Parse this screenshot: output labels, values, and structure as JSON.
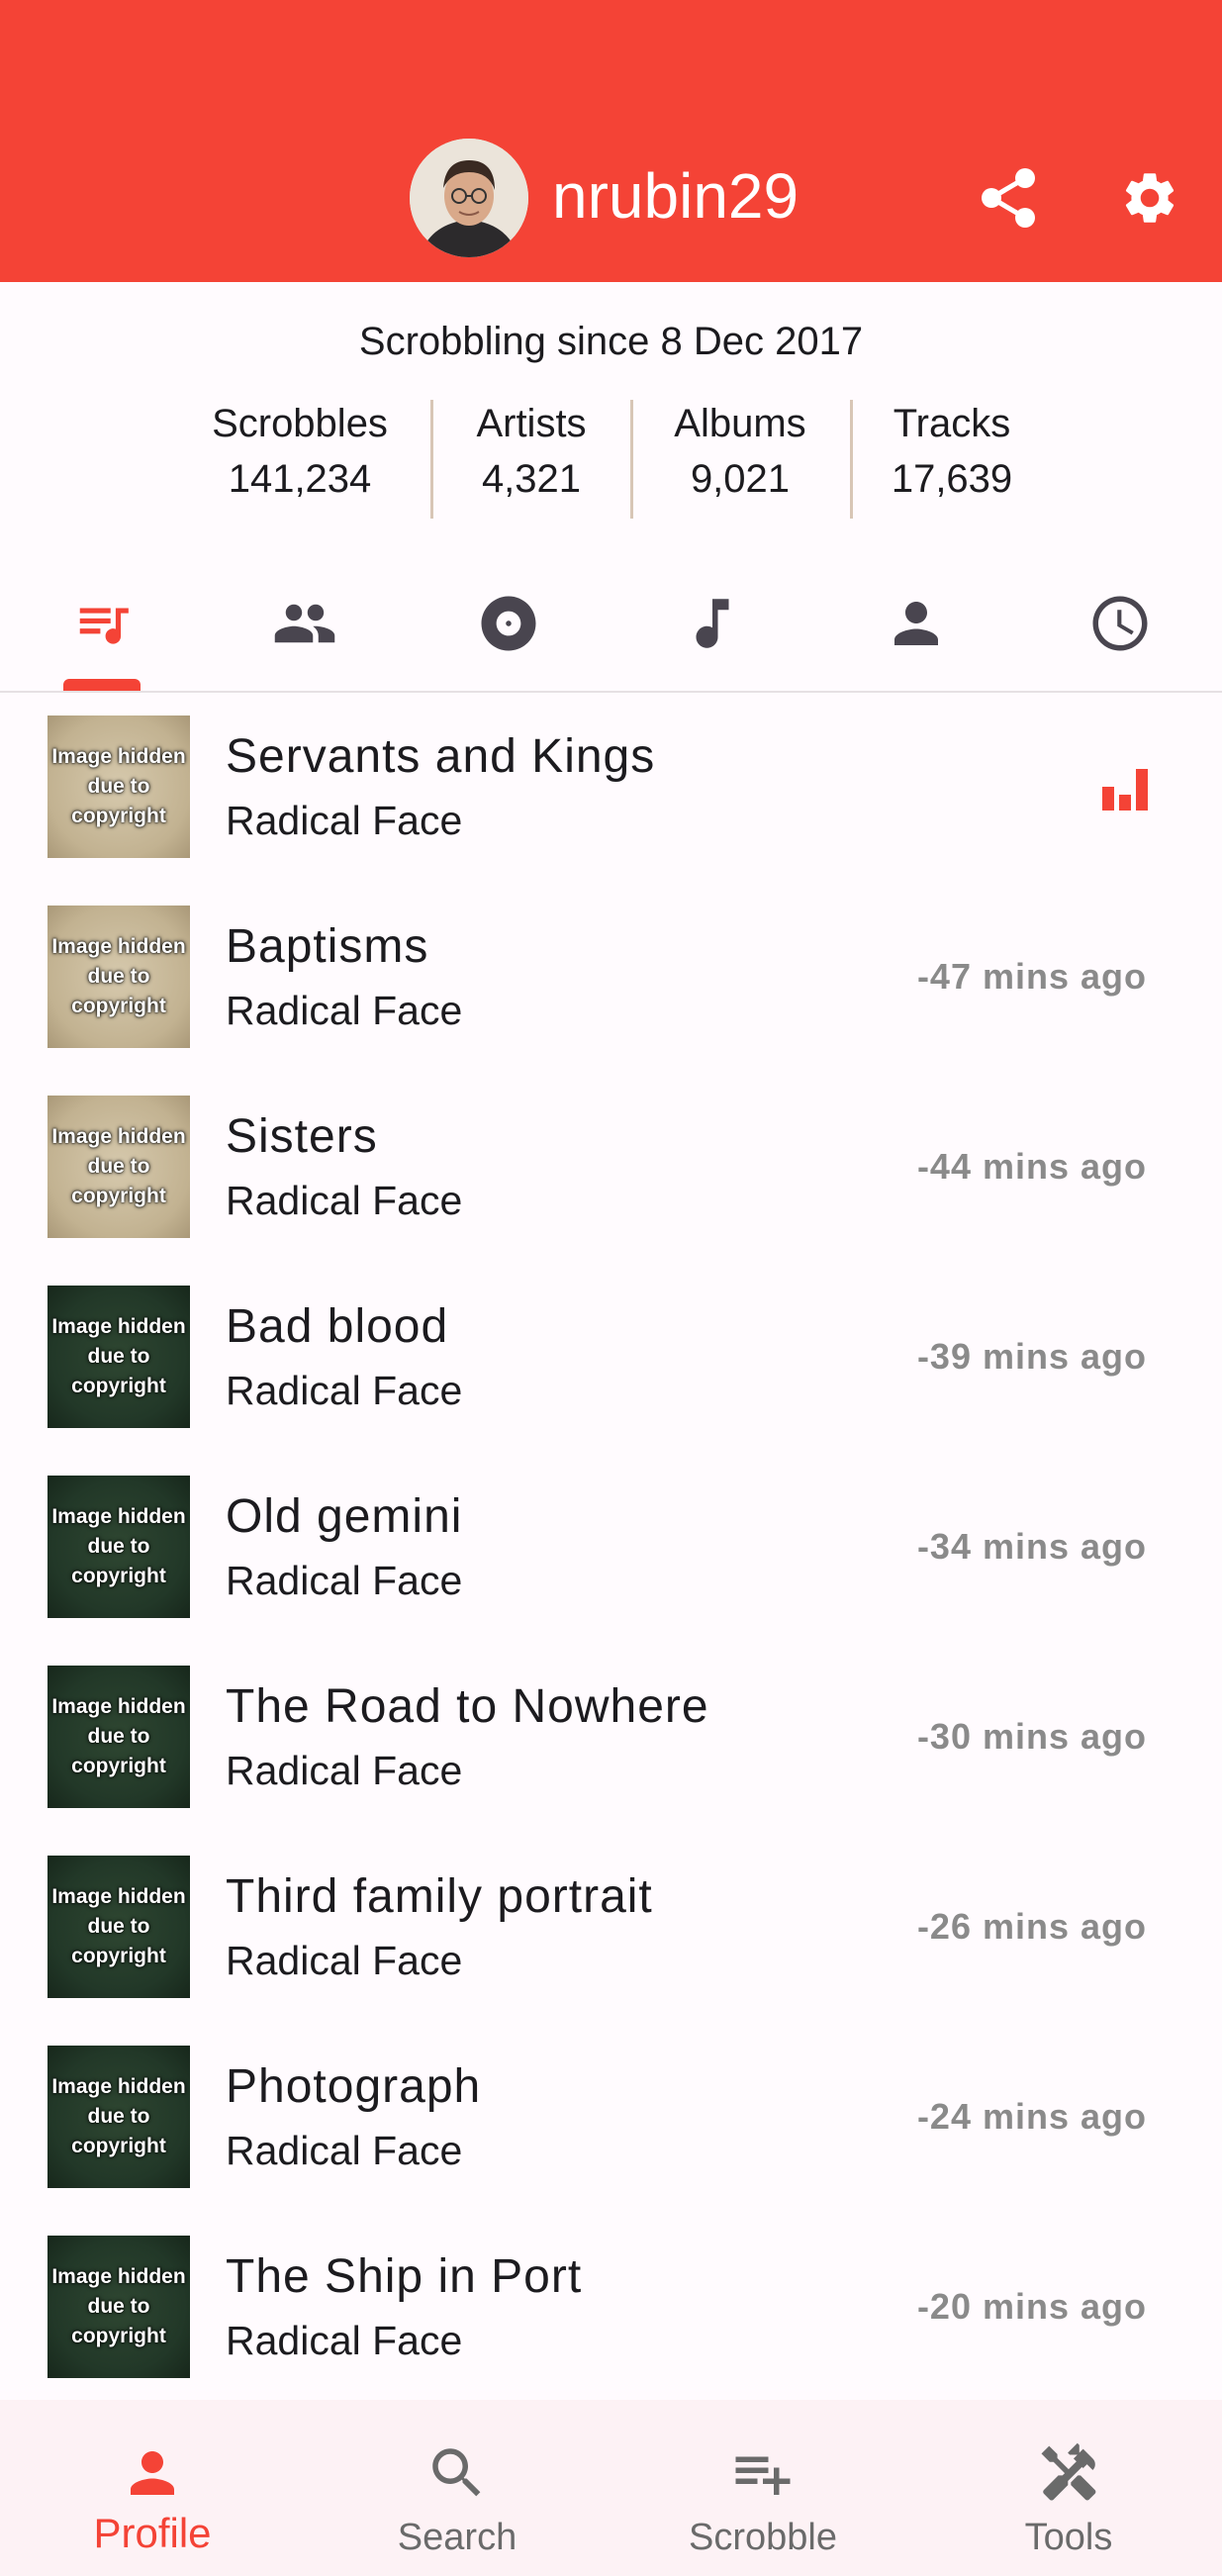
{
  "header": {
    "username": "nrubin29",
    "avatar_icon": "user-avatar-photo",
    "share_icon": "share-icon",
    "settings_icon": "gear-icon",
    "color": "#f44336"
  },
  "profile": {
    "since": "Scrobbling since 8 Dec 2017",
    "stats": [
      {
        "label": "Scrobbles",
        "value": "141,234"
      },
      {
        "label": "Artists",
        "value": "4,321"
      },
      {
        "label": "Albums",
        "value": "9,021"
      },
      {
        "label": "Tracks",
        "value": "17,639"
      }
    ]
  },
  "tabs": [
    {
      "name": "scrobbles-tab",
      "icon": "queue-music-icon",
      "selected": true
    },
    {
      "name": "artists-tab",
      "icon": "people-icon",
      "selected": false
    },
    {
      "name": "albums-tab",
      "icon": "album-icon",
      "selected": false
    },
    {
      "name": "tracks-tab",
      "icon": "music-note-icon",
      "selected": false
    },
    {
      "name": "friends-tab",
      "icon": "person-icon",
      "selected": false
    },
    {
      "name": "history-tab",
      "icon": "clock-icon",
      "selected": false
    }
  ],
  "thumbnail_text": "Image hidden due to copyright",
  "scrobbles": [
    {
      "title": "Servants and Kings",
      "artist": "Radical Face",
      "time": "",
      "now_playing": true,
      "art": "light"
    },
    {
      "title": "Baptisms",
      "artist": "Radical Face",
      "time": "-47 mins ago",
      "art": "light"
    },
    {
      "title": "Sisters",
      "artist": "Radical Face",
      "time": "-44 mins ago",
      "art": "light"
    },
    {
      "title": "Bad blood",
      "artist": "Radical Face",
      "time": "-39 mins ago",
      "art": "dark"
    },
    {
      "title": "Old gemini",
      "artist": "Radical Face",
      "time": "-34 mins ago",
      "art": "dark"
    },
    {
      "title": "The Road to Nowhere",
      "artist": "Radical Face",
      "time": "-30 mins ago",
      "art": "dark"
    },
    {
      "title": "Third family portrait",
      "artist": "Radical Face",
      "time": "-26 mins ago",
      "art": "dark"
    },
    {
      "title": "Photograph",
      "artist": "Radical Face",
      "time": "-24 mins ago",
      "art": "dark"
    },
    {
      "title": "The Ship in Port",
      "artist": "Radical Face",
      "time": "-20 mins ago",
      "art": "dark"
    }
  ],
  "bottom_nav": {
    "profile": "Profile",
    "search": "Search",
    "scrobble": "Scrobble",
    "tools": "Tools",
    "active": "profile"
  }
}
